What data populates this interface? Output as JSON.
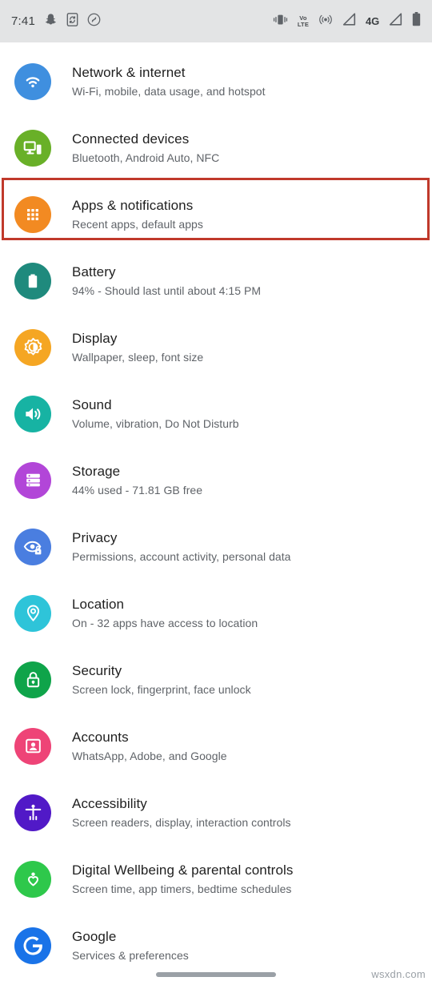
{
  "status_bar": {
    "time": "7:41",
    "left_icons": [
      "snapchat-icon",
      "screen-cast-phone-icon",
      "shazam-icon"
    ],
    "right_icons": [
      "vibrate-icon",
      "volte-icon",
      "hotspot-icon",
      "signal-bars-icon",
      "network-4g-icon",
      "signal-bars-2-icon",
      "battery-icon"
    ],
    "volte_top": "Vo",
    "volte_bottom": "LTE",
    "network_type": "4G",
    "background_color": "#e3e4e5"
  },
  "settings": {
    "items": [
      {
        "title": "Network & internet",
        "subtitle": "Wi-Fi, mobile, data usage, and hotspot",
        "icon": "wifi-icon",
        "color": "#3f8fdf",
        "highlighted": false
      },
      {
        "title": "Connected devices",
        "subtitle": "Bluetooth, Android Auto, NFC",
        "icon": "connected-devices-icon",
        "color": "#69b028",
        "highlighted": false
      },
      {
        "title": "Apps & notifications",
        "subtitle": "Recent apps, default apps",
        "icon": "apps-grid-icon",
        "color": "#f28a22",
        "highlighted": true
      },
      {
        "title": "Battery",
        "subtitle": "94% - Should last until about 4:15 PM",
        "icon": "battery-icon",
        "color": "#1f8a7d",
        "highlighted": false
      },
      {
        "title": "Display",
        "subtitle": "Wallpaper, sleep, font size",
        "icon": "brightness-icon",
        "color": "#f5a623",
        "highlighted": false
      },
      {
        "title": "Sound",
        "subtitle": "Volume, vibration, Do Not Disturb",
        "icon": "speaker-icon",
        "color": "#17b3a3",
        "highlighted": false
      },
      {
        "title": "Storage",
        "subtitle": "44% used - 71.81 GB free",
        "icon": "storage-icon",
        "color": "#b246d8",
        "highlighted": false
      },
      {
        "title": "Privacy",
        "subtitle": "Permissions, account activity, personal data",
        "icon": "eye-lock-icon",
        "color": "#4a7ee0",
        "highlighted": false
      },
      {
        "title": "Location",
        "subtitle": "On - 32 apps have access to location",
        "icon": "location-pin-icon",
        "color": "#2ec4d9",
        "highlighted": false
      },
      {
        "title": "Security",
        "subtitle": "Screen lock, fingerprint, face unlock",
        "icon": "lock-icon",
        "color": "#0fa44a",
        "highlighted": false
      },
      {
        "title": "Accounts",
        "subtitle": "WhatsApp, Adobe, and Google",
        "icon": "account-card-icon",
        "color": "#ee4477",
        "highlighted": false
      },
      {
        "title": "Accessibility",
        "subtitle": "Screen readers, display, interaction controls",
        "icon": "accessibility-person-icon",
        "color": "#5119c7",
        "highlighted": false
      },
      {
        "title": "Digital Wellbeing & parental controls",
        "subtitle": "Screen time, app timers, bedtime schedules",
        "icon": "wellbeing-heart-icon",
        "color": "#2ec84b",
        "highlighted": false
      },
      {
        "title": "Google",
        "subtitle": "Services & preferences",
        "icon": "google-g-icon",
        "color": "#1a73e8",
        "highlighted": false
      }
    ]
  },
  "highlight": {
    "color": "#c0392b"
  },
  "watermark": {
    "text": "wsxdn.com"
  }
}
